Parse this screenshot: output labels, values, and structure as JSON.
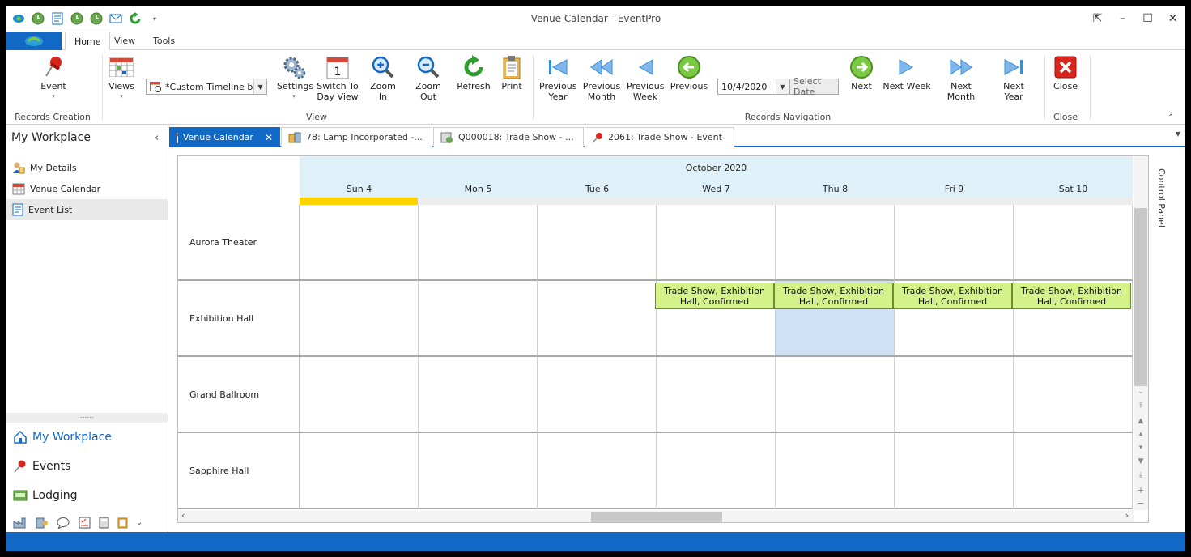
{
  "window": {
    "title": "Venue Calendar - EventPro"
  },
  "colors": {
    "accent": "#1168c5",
    "event": "#d4f28a",
    "today": "#ffd200",
    "header": "#dff0f8",
    "selection": "#cfe2f5"
  },
  "ribbon_tabs": [
    "Home",
    "View",
    "Tools"
  ],
  "ribbon": {
    "records_creation": {
      "event_label": "Event",
      "group_label": "Records Creation"
    },
    "view": {
      "views_label": "Views",
      "timeline_combo": "*Custom Timeline b...",
      "settings_label": "Settings",
      "switch_day_view": "Switch To Day View",
      "calendar_glyph_day": "1",
      "zoom_in": "Zoom In",
      "zoom_out": "Zoom Out",
      "refresh": "Refresh",
      "print": "Print",
      "group_label": "View"
    },
    "navigation": {
      "previous_year": "Previous Year",
      "previous_month": "Previous Month",
      "previous_week": "Previous Week",
      "previous": "Previous",
      "date_value": "10/4/2020",
      "select_date": "Select Date",
      "next": "Next",
      "next_week": "Next Week",
      "next_month": "Next Month",
      "next_year": "Next Year",
      "group_label": "Records Navigation"
    },
    "close": {
      "label": "Close",
      "group_label": "Close"
    }
  },
  "left_nav": {
    "title": "My Workplace",
    "items": [
      "My Details",
      "Venue Calendar",
      "Event List"
    ],
    "selected": "Event List",
    "splitter": "......",
    "sections": [
      "My Workplace",
      "Events",
      "Lodging"
    ]
  },
  "doc_tabs": [
    {
      "label": "Venue Calendar",
      "active": true
    },
    {
      "label": "78: Lamp Incorporated -...",
      "active": false
    },
    {
      "label": "Q000018: Trade Show - ...",
      "active": false
    },
    {
      "label": "2061: Trade Show - Event",
      "active": false
    }
  ],
  "calendar": {
    "month": "October 2020",
    "days": [
      "Sun 4",
      "Mon 5",
      "Tue 6",
      "Wed 7",
      "Thu 8",
      "Fri 9",
      "Sat 10"
    ],
    "resources": [
      "Aurora Theater",
      "Exhibition Hall",
      "Grand Ballroom",
      "Sapphire Hall"
    ],
    "events": [
      {
        "resource": "Exhibition Hall",
        "day": "Wed 7",
        "line1": "Trade Show, Exhibition",
        "line2": "Hall, Confirmed"
      },
      {
        "resource": "Exhibition Hall",
        "day": "Thu 8",
        "line1": "Trade Show, Exhibition",
        "line2": "Hall, Confirmed"
      },
      {
        "resource": "Exhibition Hall",
        "day": "Fri 9",
        "line1": "Trade Show, Exhibition",
        "line2": "Hall, Confirmed"
      },
      {
        "resource": "Exhibition Hall",
        "day": "Sat 10",
        "line1": "Trade Show, Exhibition",
        "line2": "Hall, Confirmed"
      }
    ],
    "control_panel": "Control Panel"
  }
}
